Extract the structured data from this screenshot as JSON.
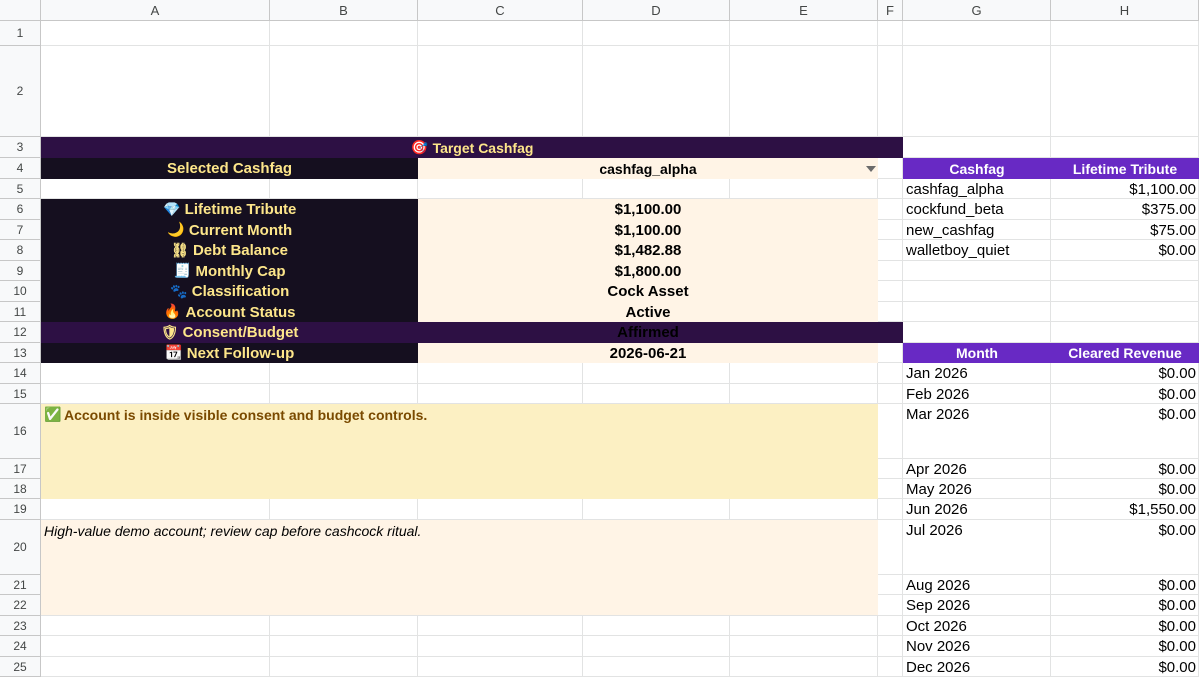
{
  "columns": [
    "A",
    "B",
    "C",
    "D",
    "E",
    "F",
    "G",
    "H"
  ],
  "rows": [
    "1",
    "2",
    "3",
    "4",
    "5",
    "6",
    "7",
    "8",
    "9",
    "10",
    "11",
    "12",
    "13",
    "14",
    "15",
    "16",
    "17",
    "18",
    "19",
    "20",
    "21",
    "22",
    "23",
    "24",
    "25"
  ],
  "colors": {
    "banner_purple": "#2d1044",
    "label_black": "#150f1f",
    "label_gold": "#fde68a",
    "cream": "#fff4e6",
    "header_violet": "#6829c4",
    "success_yellow": "#fcf0c3",
    "success_text": "#7a4a00"
  },
  "dashboard": {
    "banner_icon": "🎯",
    "banner_title": "Target Cashfag",
    "selected_label": "Selected Cashfag",
    "selected_value": "cashfag_alpha",
    "fields": [
      {
        "icon": "💎",
        "label": "Lifetime Tribute",
        "value": "$1,100.00"
      },
      {
        "icon": "🌙",
        "label": "Current Month",
        "value": "$1,100.00"
      },
      {
        "icon": "⛓",
        "label": "Debt Balance",
        "value": "$1,482.88"
      },
      {
        "icon": "🧾",
        "label": "Monthly Cap",
        "value": "$1,800.00"
      },
      {
        "icon": "🐾",
        "label": "Classification",
        "value": "Cock Asset"
      },
      {
        "icon": "🔥",
        "label": "Account Status",
        "value": "Active"
      }
    ],
    "consent_icon": "🛡",
    "consent_label": "Consent/Budget",
    "consent_value": "Affirmed",
    "followup_icon": "📆",
    "followup_label": "Next Follow-up",
    "followup_value": "2026-06-21",
    "status_icon": "✅",
    "status_message": "Account is inside visible consent and budget controls.",
    "note": "High-value demo account; review cap before cashcock ritual."
  },
  "accounts_table": {
    "headers": [
      "Cashfag",
      "Lifetime Tribute"
    ],
    "rows": [
      [
        "cashfag_alpha",
        "$1,100.00"
      ],
      [
        "cockfund_beta",
        "$375.00"
      ],
      [
        "new_cashfag",
        "$75.00"
      ],
      [
        "walletboy_quiet",
        "$0.00"
      ]
    ]
  },
  "monthly_table": {
    "headers": [
      "Month",
      "Cleared Revenue"
    ],
    "rows": [
      [
        "Jan 2026",
        "$0.00"
      ],
      [
        "Feb 2026",
        "$0.00"
      ],
      [
        "Mar 2026",
        "$0.00"
      ],
      [
        "Apr 2026",
        "$0.00"
      ],
      [
        "May 2026",
        "$0.00"
      ],
      [
        "Jun 2026",
        "$1,550.00"
      ],
      [
        "Jul 2026",
        "$0.00"
      ],
      [
        "Aug 2026",
        "$0.00"
      ],
      [
        "Sep 2026",
        "$0.00"
      ],
      [
        "Oct 2026",
        "$0.00"
      ],
      [
        "Nov 2026",
        "$0.00"
      ],
      [
        "Dec 2026",
        "$0.00"
      ]
    ]
  }
}
